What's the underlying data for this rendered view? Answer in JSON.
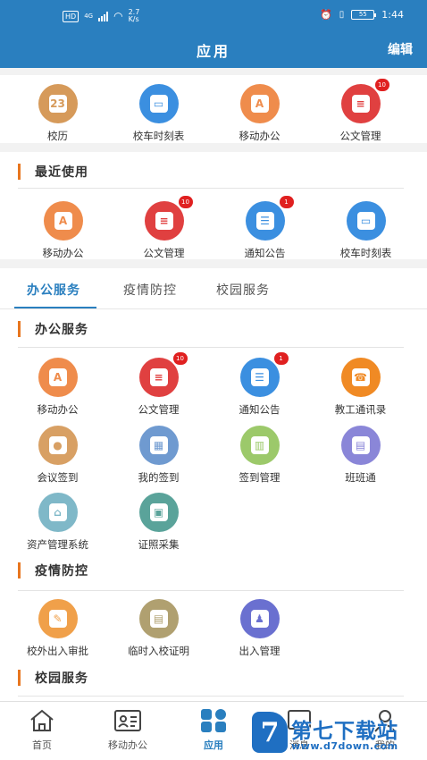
{
  "status_bar": {
    "hd": "HD",
    "network": "4G",
    "speed": "2.7",
    "speed_unit": "K/s",
    "battery": "55",
    "time": "1:44"
  },
  "header": {
    "title": "应用",
    "edit": "编辑"
  },
  "top_apps": [
    {
      "label": "校历",
      "icon": "calendar-icon",
      "color": "#d69a5a",
      "badge": ""
    },
    {
      "label": "校车时刻表",
      "icon": "bus-icon",
      "color": "#3b8fe0",
      "badge": ""
    },
    {
      "label": "移动办公",
      "icon": "office-icon",
      "color": "#ef8c4c",
      "badge": ""
    },
    {
      "label": "公文管理",
      "icon": "document-icon",
      "color": "#e04040",
      "badge": "10"
    }
  ],
  "recent": {
    "title": "最近使用",
    "apps": [
      {
        "label": "移动办公",
        "icon": "office-icon",
        "color": "#ef8c4c",
        "badge": ""
      },
      {
        "label": "公文管理",
        "icon": "document-icon",
        "color": "#e04040",
        "badge": "10"
      },
      {
        "label": "通知公告",
        "icon": "clipboard-icon",
        "color": "#3b8fe0",
        "badge": "1"
      },
      {
        "label": "校车时刻表",
        "icon": "bus-icon",
        "color": "#3b8fe0",
        "badge": ""
      }
    ]
  },
  "tabs": [
    "办公服务",
    "疫情防控",
    "校园服务"
  ],
  "office": {
    "title": "办公服务",
    "row1": [
      {
        "label": "移动办公",
        "icon": "office-icon",
        "color": "#ef8c4c",
        "badge": ""
      },
      {
        "label": "公文管理",
        "icon": "document-icon",
        "color": "#e04040",
        "badge": "10"
      },
      {
        "label": "通知公告",
        "icon": "clipboard-icon",
        "color": "#3b8fe0",
        "badge": "1"
      },
      {
        "label": "教工通讯录",
        "icon": "contacts-icon",
        "color": "#f08a24",
        "badge": ""
      }
    ],
    "row2": [
      {
        "label": "会议签到",
        "icon": "meeting-icon",
        "color": "#d8a064",
        "badge": ""
      },
      {
        "label": "我的签到",
        "icon": "checkin-icon",
        "color": "#6f9ad0",
        "badge": ""
      },
      {
        "label": "签到管理",
        "icon": "chart-icon",
        "color": "#9cc96a",
        "badge": ""
      },
      {
        "label": "班班通",
        "icon": "idcard-icon",
        "color": "#8a86d8",
        "badge": ""
      }
    ],
    "row3": [
      {
        "label": "资产管理系统",
        "icon": "bank-icon",
        "color": "#7fb8c8",
        "badge": ""
      },
      {
        "label": "证照采集",
        "icon": "photo-icon",
        "color": "#5aa39a",
        "badge": ""
      }
    ]
  },
  "epidemic": {
    "title": "疫情防控",
    "apps": [
      {
        "label": "校外出入审批",
        "icon": "approval-icon",
        "color": "#f0a04a",
        "badge": ""
      },
      {
        "label": "临时入校证明",
        "icon": "pass-icon",
        "color": "#b0a070",
        "badge": ""
      },
      {
        "label": "出入管理",
        "icon": "person-icon",
        "color": "#6a70d0",
        "badge": ""
      }
    ]
  },
  "campus": {
    "title": "校园服务"
  },
  "bottom_nav": [
    {
      "label": "首页",
      "icon": "home-icon"
    },
    {
      "label": "移动办公",
      "icon": "office-nav-icon"
    },
    {
      "label": "应用",
      "icon": "apps-grid-icon"
    },
    {
      "label": "消息",
      "icon": "message-icon"
    },
    {
      "label": "我的",
      "icon": "user-icon"
    }
  ],
  "watermark": {
    "logo": "7",
    "text": "第七下载站",
    "url": "www.d7down.com"
  }
}
